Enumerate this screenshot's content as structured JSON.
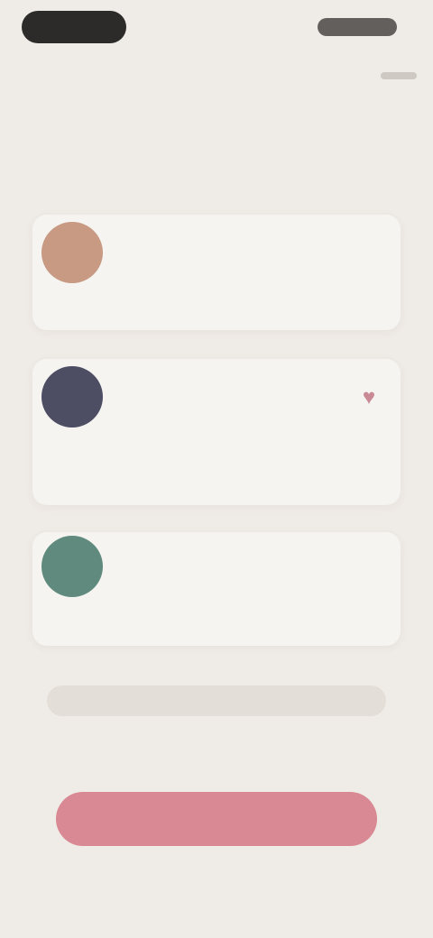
{
  "status": {
    "left_pill": "",
    "right_indicator": ""
  },
  "header": {
    "headline": "",
    "subheadline": ""
  },
  "cards": [
    {
      "name": "",
      "subtitle": "",
      "description": "",
      "avatar_color": "#c99a83"
    },
    {
      "name": "",
      "subtitle": "",
      "description": "",
      "avatar_color": "#4d4d63",
      "heart": "♥"
    },
    {
      "name": "",
      "subtitle": "",
      "description": "",
      "avatar_color": "#5f8a7d"
    }
  ],
  "footer": {
    "bar_text": "",
    "cta_label": "",
    "legal": ""
  },
  "colors": {
    "accent": "#d98993",
    "background": "#efebe6"
  }
}
